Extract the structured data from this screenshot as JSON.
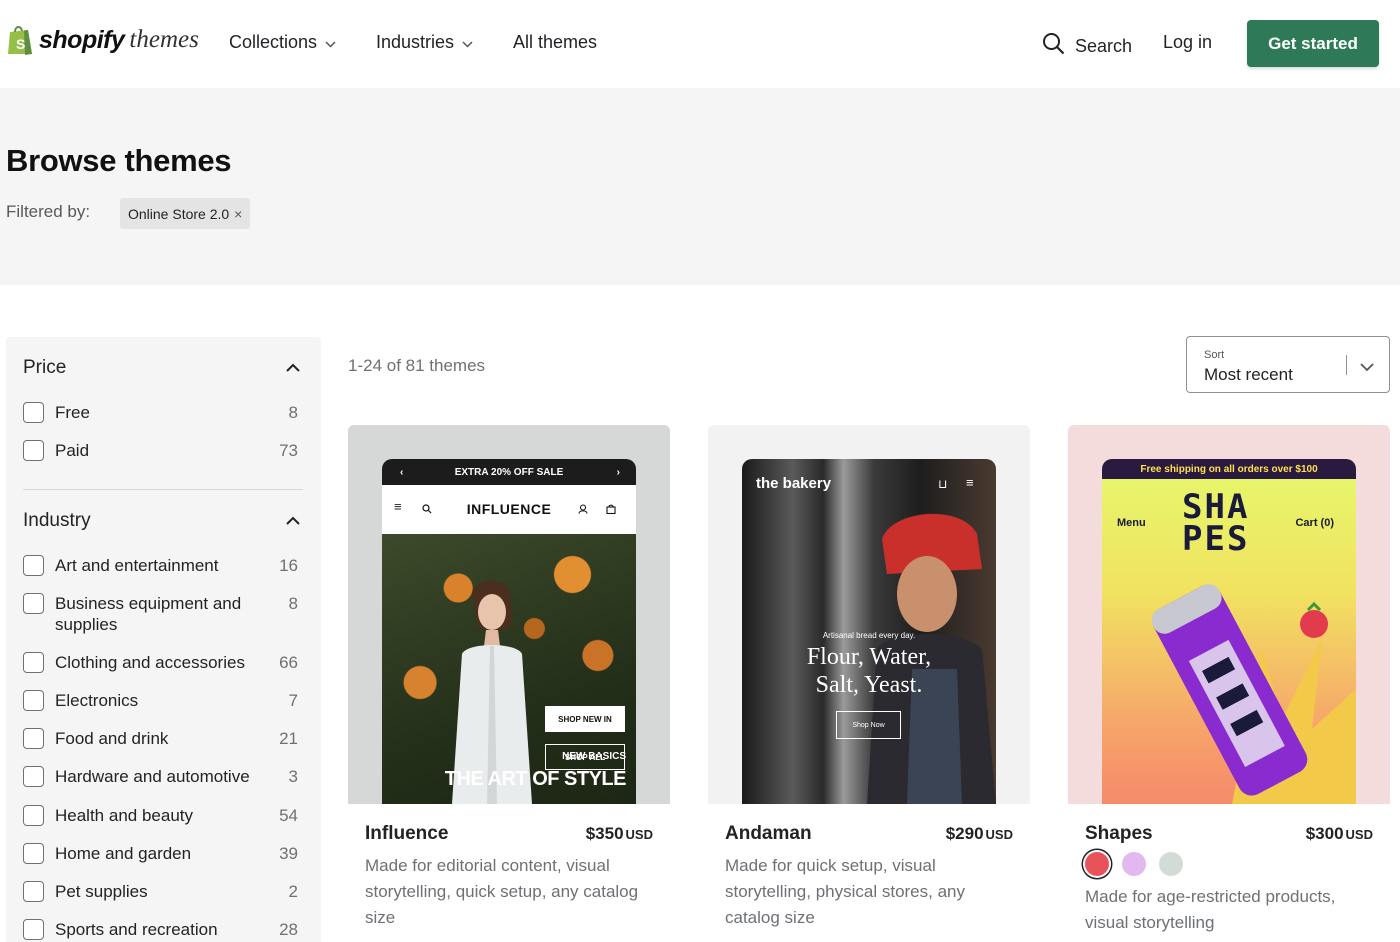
{
  "header": {
    "logo_main": "shopify",
    "logo_sub": "themes",
    "nav": [
      {
        "label": "Collections",
        "has_dropdown": true
      },
      {
        "label": "Industries",
        "has_dropdown": true
      },
      {
        "label": "All themes",
        "has_dropdown": false
      }
    ],
    "search_label": "Search",
    "login_label": "Log in",
    "cta_label": "Get started",
    "cta_color": "#2f7a56"
  },
  "hero": {
    "title": "Browse themes",
    "filtered_label": "Filtered by:",
    "chip_label": "Online Store 2.0",
    "chip_remove": "×"
  },
  "sidebar": {
    "price": {
      "title": "Price",
      "items": [
        {
          "label": "Free",
          "count": "8"
        },
        {
          "label": "Paid",
          "count": "73"
        }
      ]
    },
    "industry": {
      "title": "Industry",
      "items": [
        {
          "label": "Art and entertainment",
          "count": "16"
        },
        {
          "label": "Business equipment and supplies",
          "count": "8"
        },
        {
          "label": "Clothing and accessories",
          "count": "66"
        },
        {
          "label": "Electronics",
          "count": "7"
        },
        {
          "label": "Food and drink",
          "count": "21"
        },
        {
          "label": "Hardware and automotive",
          "count": "3"
        },
        {
          "label": "Health and beauty",
          "count": "54"
        },
        {
          "label": "Home and garden",
          "count": "39"
        },
        {
          "label": "Pet supplies",
          "count": "2"
        },
        {
          "label": "Sports and recreation",
          "count": "28"
        }
      ]
    }
  },
  "results": {
    "count_text": "1-24 of 81 themes",
    "sort_label": "Sort",
    "sort_value": "Most recent"
  },
  "cards": [
    {
      "name": "Influence",
      "price": "$350",
      "currency": "USD",
      "description": "Made for editorial content, visual storytelling, quick setup, any catalog size",
      "bg": "#d5d8d6",
      "preview": {
        "banner": "EXTRA 20% OFF SALE",
        "brand": "INFLUENCE",
        "kicker": "NEW BASICS",
        "headline": "THE ART OF STYLE",
        "button1": "SHOP NEW IN",
        "button2": "SHOP ALL"
      }
    },
    {
      "name": "Andaman",
      "price": "$290",
      "currency": "USD",
      "description": "Made for quick setup, visual storytelling, physical stores, any catalog size",
      "bg": "#f2f2f2",
      "preview": {
        "brand": "the bakery",
        "small": "Artisanal bread every day.",
        "headline1": "Flour, Water,",
        "headline2": "Salt, Yeast.",
        "button": "Shop Now"
      }
    },
    {
      "name": "Shapes",
      "price": "$300",
      "currency": "USD",
      "description": "Made for age-restricted products, visual storytelling",
      "bg": "#f4dcdc",
      "swatches": [
        "#e8535a",
        "#e2b8f0",
        "#d3dbd6"
      ],
      "preview": {
        "banner": "Free shipping on all orders over $100",
        "menu": "Menu",
        "brand1": "SHA",
        "brand2": "PES",
        "cart": "Cart (0)"
      }
    }
  ]
}
